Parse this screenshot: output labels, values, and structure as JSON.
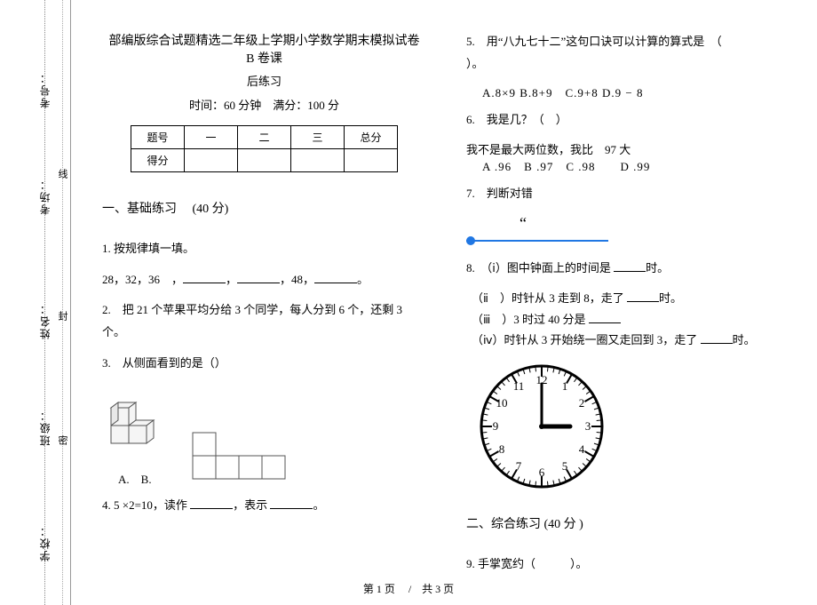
{
  "binding": {
    "labels": [
      "考号：",
      "考场：",
      "姓名：",
      "班级：",
      "学校："
    ],
    "marks": [
      "线",
      "封",
      "密"
    ]
  },
  "header": {
    "title": "部编版综合试题精选二年级上学期小学数学期末模拟试卷　　B 卷课",
    "subtitle": "后练习",
    "time_label": "时间：",
    "time_value": "60 分钟",
    "full_label": "满分：",
    "full_value": "100 分"
  },
  "score_table": {
    "row1": [
      "题号",
      "一",
      "二",
      "三",
      "总分"
    ],
    "row2_header": "得分"
  },
  "section1_heading": "一、基础练习　 (40 分)",
  "q1": {
    "num": "1.",
    "text": "按规律填一填。",
    "seq_prefix": "28，32，36　，",
    "seq_mid": "，",
    "seq_mid2": "，48，",
    "seq_end": "。"
  },
  "q2": {
    "text": "2.　把 21 个苹果平均分给 3 个同学，每人分到 6 个，还剩 3 个。"
  },
  "q3": {
    "text": "3.　从侧面看到的是（）"
  },
  "q3_opts": {
    "a": "A.",
    "b": "B."
  },
  "q4": {
    "prefix": "4. 5 ×2=10，读作",
    "mid": "，表示",
    "end": "。"
  },
  "q5": {
    "text": "5.　用“八九七十二”这句口诀可以计算的算式是　（",
    "paren_close": "）。",
    "opts": "A.8×9 B.8+9　C.9+8  D.9 − 8"
  },
  "q6": {
    "text": "6.　我是几？（　）",
    "line2": "我不是最大两位数，我比　97 大",
    "opts": " A .96　B .97　C .98　　D .99"
  },
  "q7": {
    "text": "7.　判断对错",
    "quote": "“"
  },
  "q8": {
    "line1_a": "8.　（ⅰ）图中钟面上的时间是",
    "line1_b": "时。",
    "line2_a": "（ⅱ　）时针从 3 走到 8，走了",
    "line2_b": "时。",
    "line3": "（ⅲ　）3 时过 40 分是",
    "line4_a": "（ⅳ）时针从 3 开始绕一圈又走回到 3，走了",
    "line4_b": "时。"
  },
  "section2_heading": "二、综合练习  (40 分 )",
  "q9": {
    "text": "9. 手掌宽约（　　　）。"
  },
  "footer": "第 1 页　 /　共 3 页",
  "chart_data": {
    "type": "clock",
    "hour": 3,
    "minute": 0,
    "numerals": [
      1,
      2,
      3,
      4,
      5,
      6,
      7,
      8,
      9,
      10,
      11,
      12
    ]
  }
}
